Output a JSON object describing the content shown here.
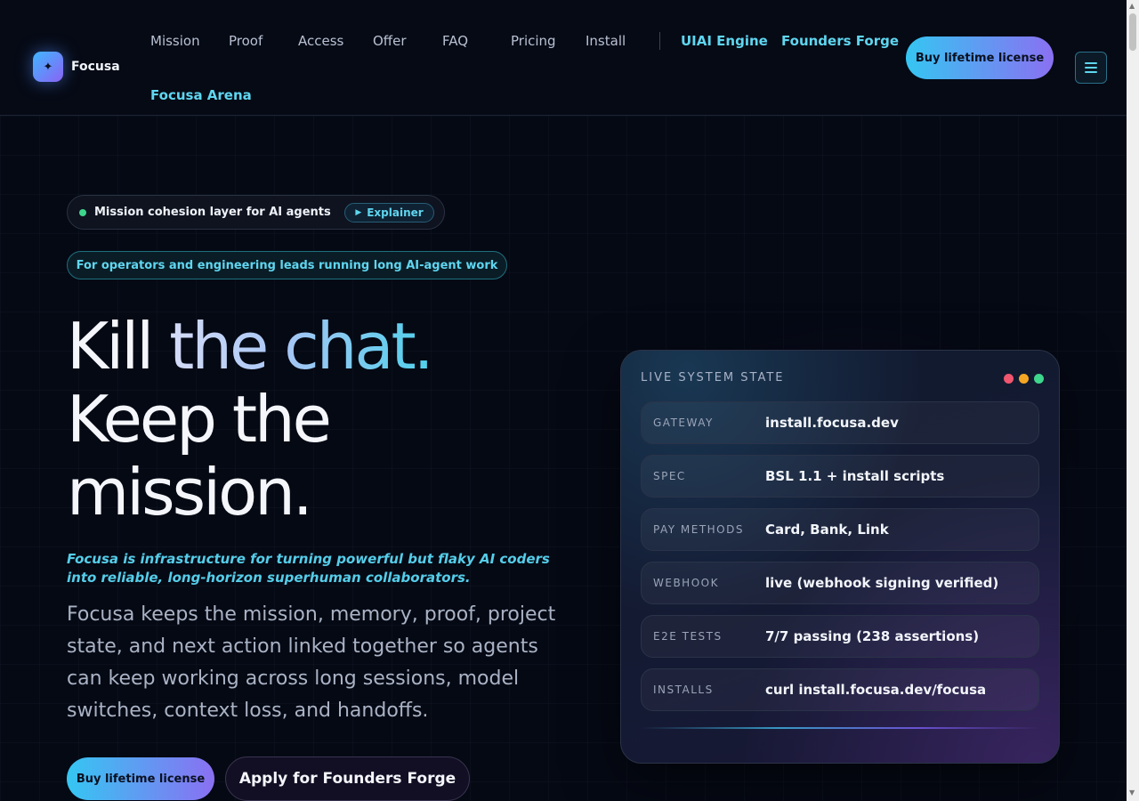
{
  "header": {
    "logo_text": "Focusa",
    "logo_icon": "sparkle-icon",
    "nav": [
      "Mission",
      "Proof",
      "Access",
      "Offer",
      "FAQ",
      "Pricing",
      "Install"
    ],
    "accent_links": [
      "UIAI Engine",
      "Founders Forge",
      "Focusa Arena"
    ],
    "cta_label": "Buy lifetime license",
    "menu_icon": "hamburger-menu-icon"
  },
  "hero": {
    "badge_text": "Mission cohesion layer for AI agents",
    "explainer_label": "Explainer",
    "audience_text": "For operators and engineering leads running long AI-agent work",
    "title_line1_a": "Kill ",
    "title_line1_b": "the chat.",
    "title_line2": "Keep the",
    "title_line3": "mission.",
    "tagline": "Focusa is infrastructure for turning powerful but flaky AI coders into reliable, long-horizon superhuman collaborators.",
    "description": "Focusa keeps the mission, memory, proof, project state, and next action linked together so agents can keep working across long sessions, model switches, context loss, and handoffs.",
    "primary_cta": "Buy lifetime license",
    "secondary_cta": "Apply for Founders Forge"
  },
  "state_card": {
    "title": "LIVE SYSTEM STATE",
    "dots": [
      "#f0566e",
      "#f5a623",
      "#3ed68c"
    ],
    "rows": [
      {
        "key": "GATEWAY",
        "value": "install.focusa.dev"
      },
      {
        "key": "SPEC",
        "value": "BSL 1.1 + install scripts"
      },
      {
        "key": "PAY METHODS",
        "value": "Card, Bank, Link"
      },
      {
        "key": "WEBHOOK",
        "value": "live (webhook signing verified)"
      },
      {
        "key": "E2E TESTS",
        "value": "7/7 passing (238 assertions)"
      },
      {
        "key": "INSTALLS",
        "value": "curl install.focusa.dev/focusa"
      }
    ]
  },
  "colors": {
    "accent": "#5fd6f0",
    "background": "#050914",
    "gradient_start": "#35c6f2",
    "gradient_end": "#8a70f2"
  }
}
